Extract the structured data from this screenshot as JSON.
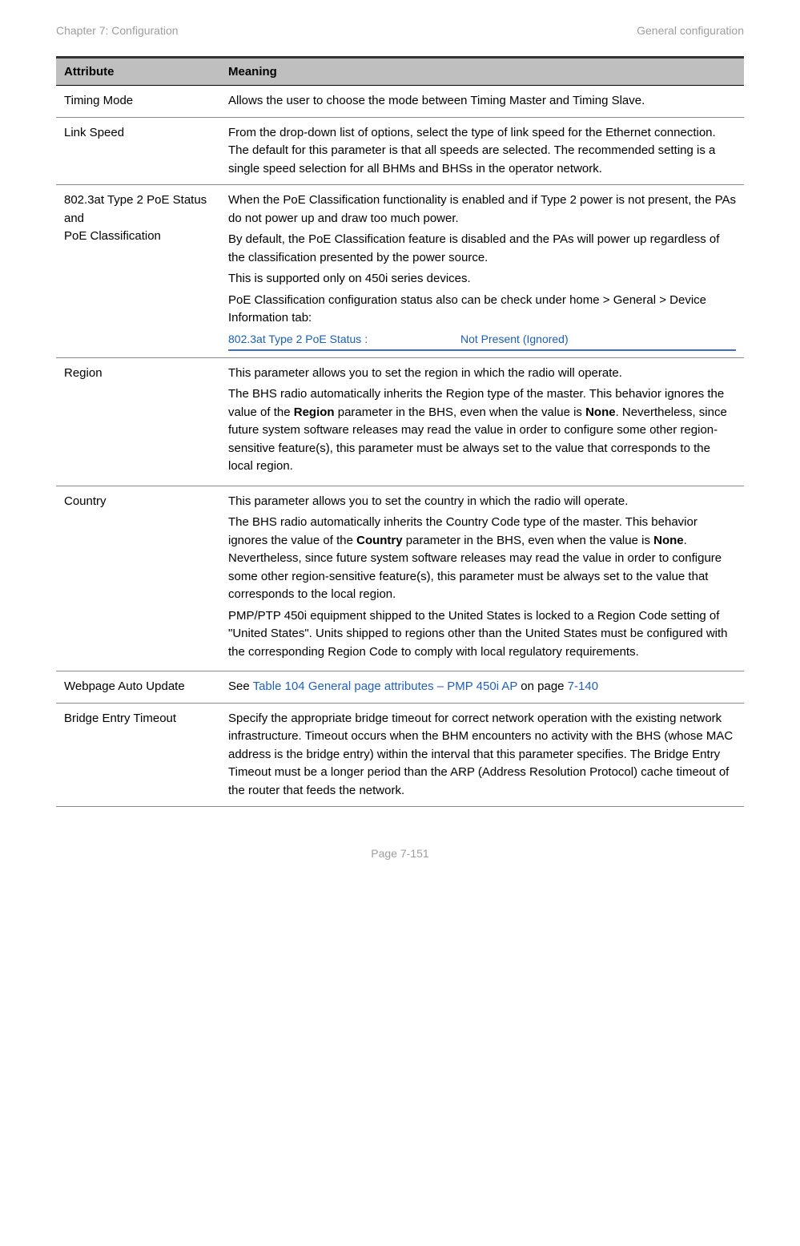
{
  "header": {
    "left": "Chapter 7:  Configuration",
    "right": "General configuration"
  },
  "table": {
    "headers": {
      "attribute": "Attribute",
      "meaning": "Meaning"
    },
    "rows": {
      "timing_mode": {
        "attr": " Timing Mode",
        "meaning": "Allows the user to choose the mode between Timing Master and Timing Slave."
      },
      "link_speed": {
        "attr": "Link Speed",
        "meaning": "From the drop-down list of options, select the type of link speed for the Ethernet connection. The default for this parameter is that all speeds are selected. The recommended setting is a single speed selection for all BHMs and BHSs in the operator network."
      },
      "poe": {
        "attr_line1": "802.3at Type 2 PoE Status and",
        "attr_line2": "PoE Classification",
        "p1": "When the PoE Classification functionality is enabled and if Type 2 power is not present, the PAs do not power up and draw too much power.",
        "p2": "By default, the PoE Classification feature is disabled and the PAs will power up regardless of the classification presented by the power source.",
        "p3": "This is supported only on 450i series devices.",
        "p4": "PoE Classification configuration status also can be check under home > General > Device Information tab:",
        "status_label": "802.3at Type 2 PoE Status :",
        "status_value": "Not Present (Ignored)"
      },
      "region": {
        "attr": "Region",
        "p1": "This parameter allows you to set the region in which the radio will operate.",
        "p2a": "The BHS radio automatically inherits the Region type of the master. This behavior ignores the value of the ",
        "p2b_bold": "Region",
        "p2c": " parameter in the BHS, even when the value is ",
        "p2d_bold": "None",
        "p2e": ". Nevertheless, since future system software releases may read the value in order to configure some other region-sensitive feature(s), this parameter must be always set to the value that corresponds to the local region."
      },
      "country": {
        "attr": "Country",
        "p1": "This parameter allows you to set the country in which the radio will operate.",
        "p2a": "The BHS radio automatically inherits the Country Code type of the master. This behavior ignores the value of the ",
        "p2b_bold": "Country",
        "p2c": " parameter in the BHS, even when the value is ",
        "p2d_bold": "None",
        "p2e": ". Nevertheless, since future system software releases may read the value in order to configure some other region-sensitive feature(s), this parameter must be always set to the value that corresponds to the local region.",
        "p3": "PMP/PTP 450i equipment shipped to the United States is locked to a Region Code setting of \"United States\". Units shipped to regions other than the United States must be configured with the corresponding Region Code to comply with local regulatory requirements."
      },
      "webpage": {
        "attr": "Webpage Auto Update",
        "see": "See ",
        "link_text": "Table 104 General page attributes – PMP 450i AP",
        "on_page": " on page ",
        "page_link": "7-140"
      },
      "bridge": {
        "attr": "Bridge Entry Timeout",
        "meaning": "Specify the appropriate bridge timeout for correct network operation with the existing network infrastructure. Timeout occurs when the BHM encounters no activity with the BHS (whose MAC address is the bridge entry) within the interval that this parameter specifies. The Bridge Entry Timeout must be a longer period than the ARP (Address Resolution Protocol) cache timeout of the router that feeds the network."
      }
    }
  },
  "footer": "Page 7-151"
}
